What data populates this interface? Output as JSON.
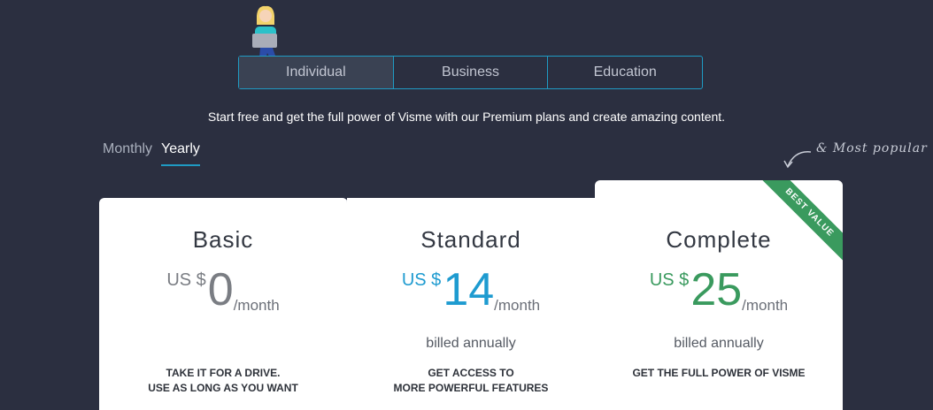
{
  "tabs": [
    "Individual",
    "Business",
    "Education"
  ],
  "subtitle": "Start free and get the full power of Visme with our Premium plans and create amazing content.",
  "billing_toggle": {
    "monthly": "Monthly",
    "yearly": "Yearly",
    "selected": "Yearly"
  },
  "popular_note": "& Most popular",
  "plans": [
    {
      "name": "Basic",
      "currency": "US $",
      "amount": "0",
      "per": "/month",
      "billed": "",
      "tagline": [
        "TAKE IT FOR A DRIVE.",
        "USE AS LONG AS YOU WANT"
      ],
      "color": "#7a7d83"
    },
    {
      "name": "Standard",
      "currency": "US $",
      "amount": "14",
      "per": "/month",
      "billed": "billed annually",
      "tagline": [
        "GET ACCESS TO",
        "MORE POWERFUL FEATURES"
      ],
      "color": "#1e9bd0"
    },
    {
      "name": "Complete",
      "currency": "US $",
      "amount": "25",
      "per": "/month",
      "billed": "billed annually",
      "tagline": [
        "GET THE FULL POWER OF VISME"
      ],
      "badge": "BEST VALUE",
      "color": "#3a9a5e"
    }
  ],
  "colors": {
    "background": "#2b2f40",
    "accent": "#1f9bc4"
  },
  "icons": {
    "mascot": "person-with-laptop-icon",
    "arrow": "curved-arrow-icon"
  }
}
